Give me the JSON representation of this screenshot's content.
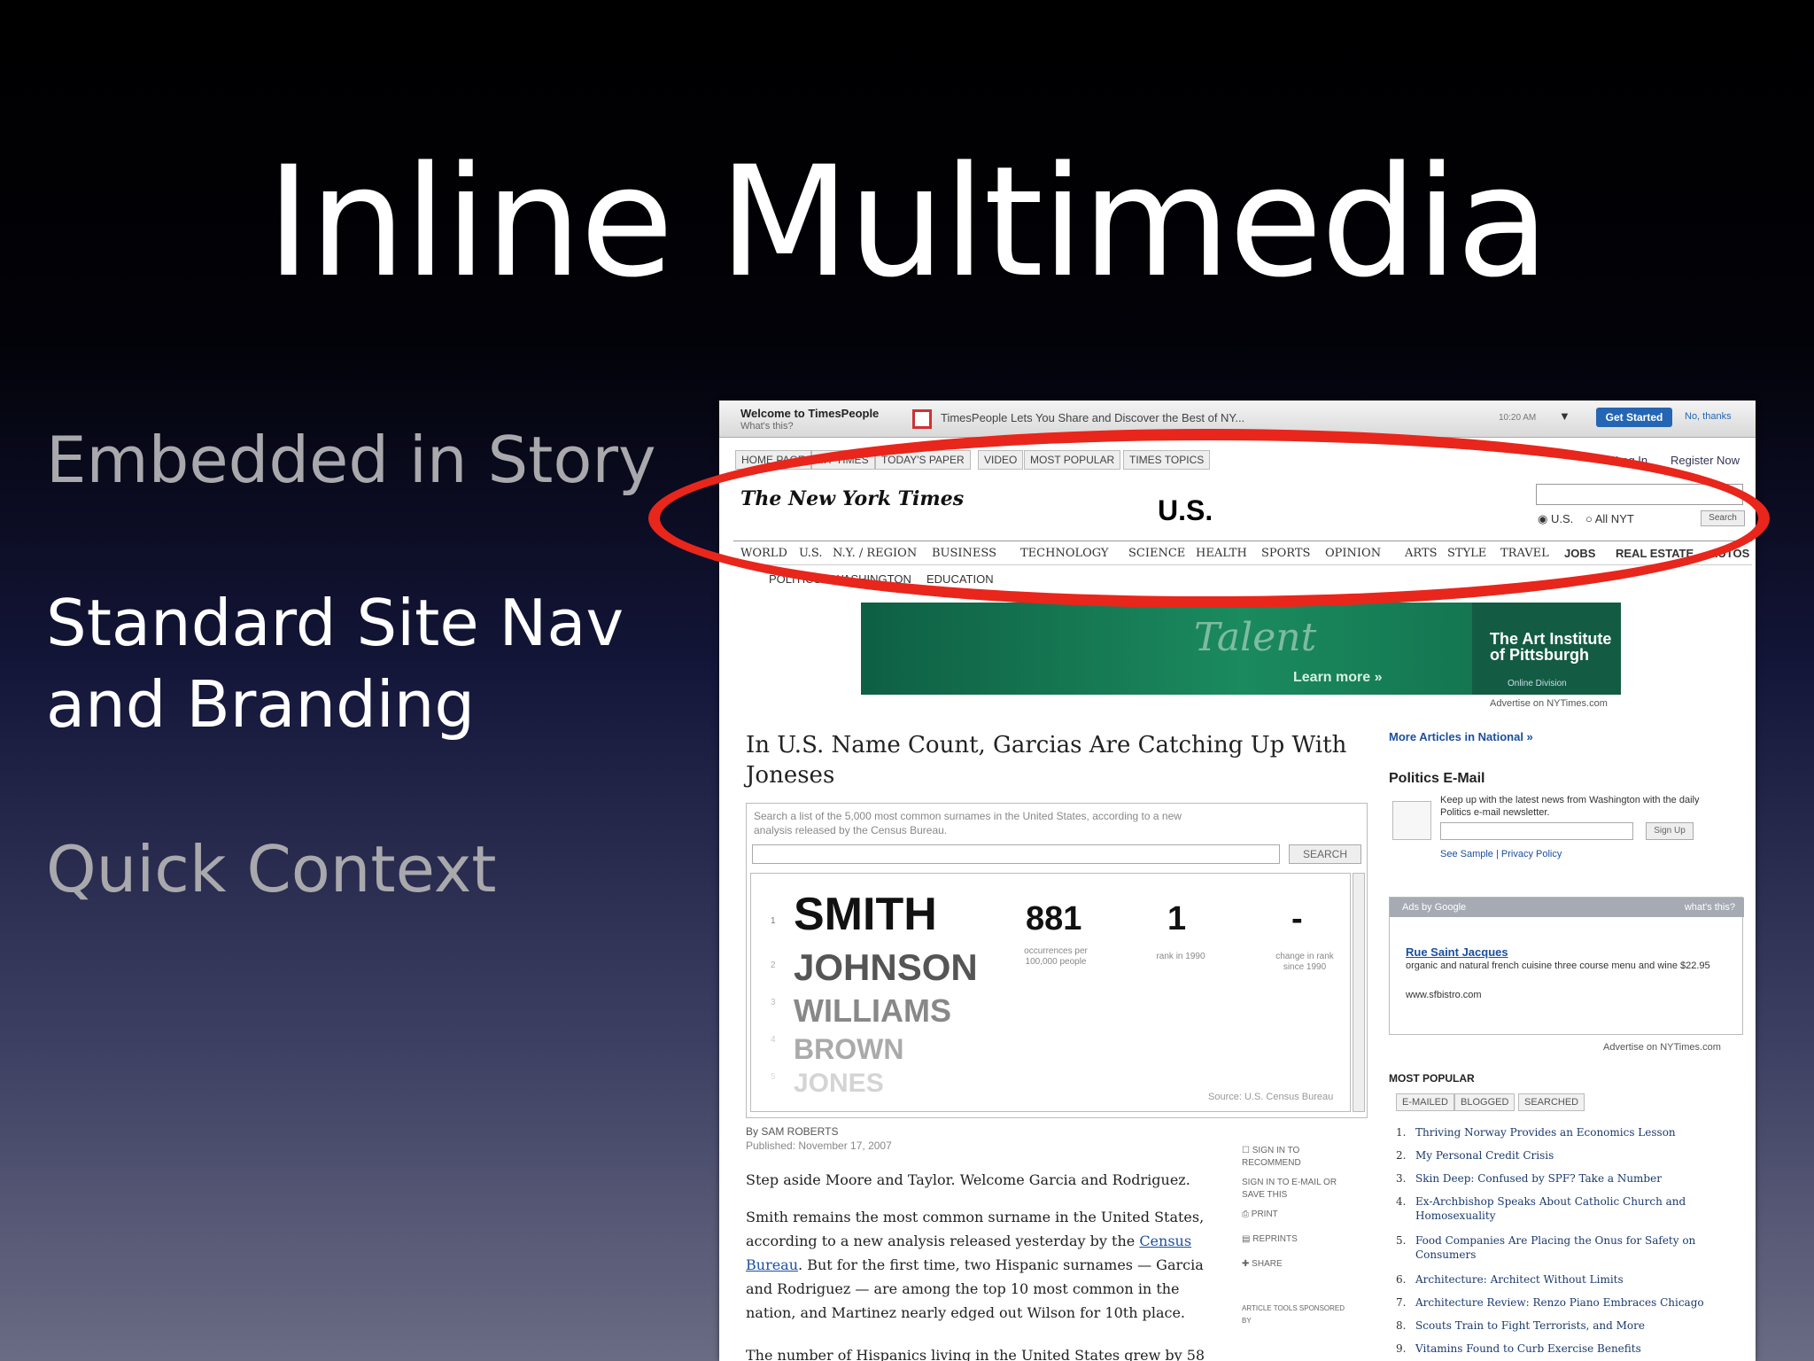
{
  "slide": {
    "title": "Inline Multimedia",
    "bullets": [
      "Embedded in Story",
      "Standard Site Nav",
      "and Branding",
      "Quick Context"
    ]
  },
  "colors": {
    "highlight": "#e8261c",
    "accent_link": "#1a4f9e"
  },
  "screenshot": {
    "timespeople": {
      "welcome": "Welcome to TimesPeople",
      "whats_this": "What's this?",
      "message": "TimesPeople Lets You Share and Discover the Best of NY...",
      "time": "10:20 AM",
      "get_started": "Get Started",
      "no_thanks": "No, thanks"
    },
    "top_tabs": [
      "HOME PAGE",
      "MY TIMES",
      "TODAY'S PAPER",
      "VIDEO",
      "MOST POPULAR",
      "TIMES TOPICS"
    ],
    "login": "Log In",
    "register": "Register Now",
    "masthead": "The New York Times",
    "section": "U.S.",
    "search_options": [
      "U.S.",
      "All NYT"
    ],
    "search_button": "Search",
    "nav": [
      "WORLD",
      "U.S.",
      "N.Y. / REGION",
      "BUSINESS",
      "TECHNOLOGY",
      "SCIENCE",
      "HEALTH",
      "SPORTS",
      "OPINION",
      "ARTS",
      "STYLE",
      "TRAVEL",
      "JOBS",
      "REAL ESTATE",
      "AUTOS"
    ],
    "subnav": [
      "POLITICS",
      "WASHINGTON",
      "EDUCATION"
    ],
    "ad": {
      "word": "Talent",
      "learn_more": "Learn more »",
      "institute_line1": "The Art Institute",
      "institute_line2": "of Pittsburgh",
      "division": "Online Division",
      "advertise": "Advertise on NYTimes.com"
    },
    "headline": "In U.S. Name Count, Garcias Are Catching Up With Joneses",
    "interactive": {
      "intro": "Search a list of the 5,000 most common surnames in the United States, according to a new analysis released by the Census Bureau.",
      "search_button": "SEARCH",
      "names": [
        "SMITH",
        "JOHNSON",
        "WILLIAMS",
        "BROWN",
        "JONES"
      ],
      "ranks": [
        "1",
        "2",
        "3",
        "4",
        "5"
      ],
      "occurrences": "881",
      "occurrences_label": "occurrences per 100,000 people",
      "rank_1990": "1",
      "rank_label": "rank in 1990",
      "change": "-",
      "change_label": "change in rank since 1990",
      "source": "Source: U.S. Census Bureau"
    },
    "byline": "By SAM ROBERTS",
    "published": "Published: November 17, 2007",
    "paragraphs": {
      "p1": "Step aside Moore and Taylor. Welcome Garcia and Rodriguez.",
      "p2_before": "Smith remains the most common surname in the United States, according to a new analysis released yesterday by the ",
      "p2_link": "Census Bureau",
      "p2_after": ". But for the first time, two Hispanic surnames — Garcia and Rodriguez — are among the top 10 most common in the nation, and Martinez nearly edged out Wilson for 10th place.",
      "p3": "The number of Hispanics living in the United States grew by 58"
    },
    "tools": [
      "SIGN IN TO RECOMMEND",
      "SIGN IN TO E-MAIL OR SAVE THIS",
      "PRINT",
      "REPRINTS",
      "SHARE",
      "ARTICLE TOOLS SPONSORED BY"
    ],
    "sidebar": {
      "more_articles": "More Articles in National »",
      "politics_title": "Politics E-Mail",
      "politics_text": "Keep up with the latest news from Washington with the daily Politics e-mail newsletter.",
      "sign_up": "Sign Up",
      "see_sample": "See Sample | Privacy Policy",
      "ads_by_google": "Ads by Google",
      "whats_this": "what's this?",
      "ad_link": "Rue Saint Jacques",
      "ad_text": "organic and natural french cuisine three course menu and wine $22.95",
      "ad_url": "www.sfbistro.com",
      "advertise": "Advertise on NYTimes.com",
      "most_popular": "MOST POPULAR",
      "mp_tabs": [
        "E-MAILED",
        "BLOGGED",
        "SEARCHED"
      ],
      "mp_items": [
        "Thriving Norway Provides an Economics Lesson",
        "My Personal Credit Crisis",
        "Skin Deep: Confused by SPF? Take a Number",
        "Ex-Archbishop Speaks About Catholic Church and Homosexuality",
        "Food Companies Are Placing the Onus for Safety on Consumers",
        "Architecture: Architect Without Limits",
        "Architecture Review: Renzo Piano Embraces Chicago",
        "Scouts Train to Fight Terrorists, and More",
        "Vitamins Found to Curb Exercise Benefits"
      ]
    }
  }
}
